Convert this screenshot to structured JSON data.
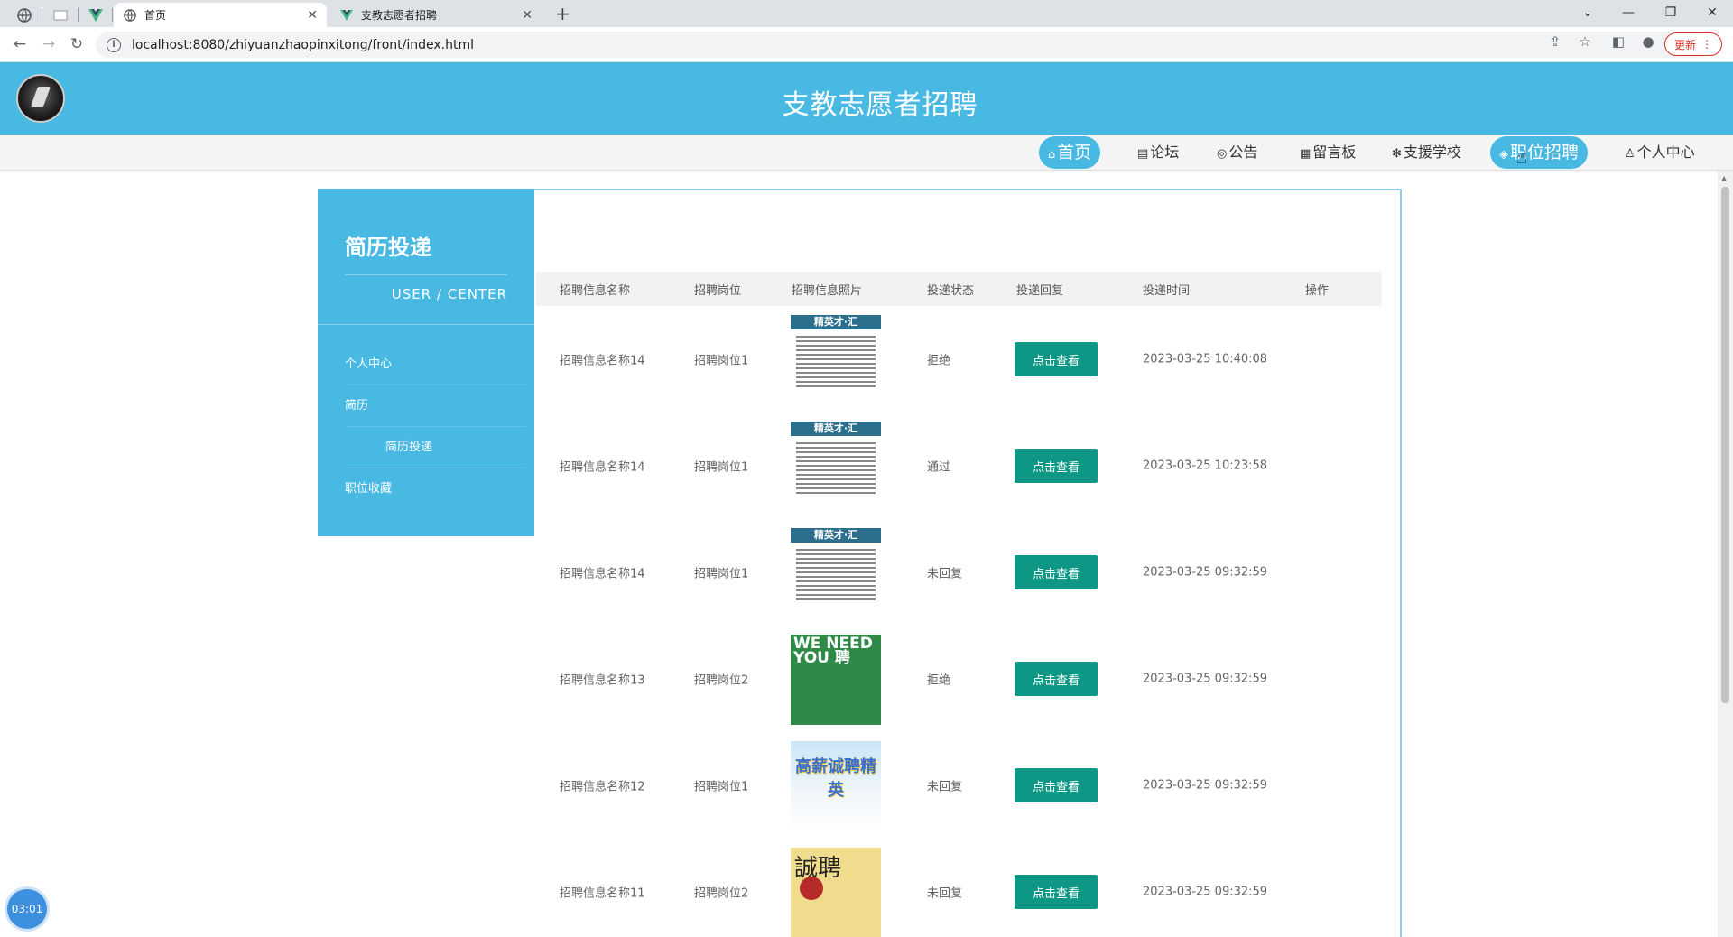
{
  "browser": {
    "tabs": [
      {
        "title": "首页",
        "icon": "globe-icon",
        "active": true
      },
      {
        "title": "支教志愿者招聘",
        "icon": "vue-logo-icon",
        "active": false
      }
    ],
    "url": "localhost:8080/zhiyuanzhaopinxitong/front/index.html",
    "update_label": "更新"
  },
  "site": {
    "title": "支教志愿者招聘"
  },
  "nav": {
    "items": [
      {
        "label": "首页",
        "icon": "⌂",
        "active": true
      },
      {
        "label": "论坛",
        "icon": "▤",
        "active": false
      },
      {
        "label": "公告",
        "icon": "◎",
        "active": false
      },
      {
        "label": "留言板",
        "icon": "▦",
        "active": false
      },
      {
        "label": "支援学校",
        "icon": "✻",
        "active": false
      },
      {
        "label": "职位招聘",
        "icon": "◈",
        "active": true
      },
      {
        "label": "个人中心",
        "icon": "♙",
        "active": false
      }
    ]
  },
  "sidebar": {
    "title": "简历投递",
    "subtitle": "USER / CENTER",
    "items": [
      {
        "label": "个人中心"
      },
      {
        "label": "简历"
      },
      {
        "label": "简历投递"
      },
      {
        "label": "职位收藏"
      }
    ]
  },
  "table": {
    "columns": [
      "招聘信息名称",
      "招聘岗位",
      "招聘信息照片",
      "投递状态",
      "投递回复",
      "投递时间",
      "操作"
    ],
    "button_label": "点击查看",
    "rows": [
      {
        "name": "招聘信息名称14",
        "position": "招聘岗位1",
        "poster": "a",
        "status": "拒绝",
        "time": "2023-03-25 10:40:08"
      },
      {
        "name": "招聘信息名称14",
        "position": "招聘岗位1",
        "poster": "a",
        "status": "通过",
        "time": "2023-03-25 10:23:58"
      },
      {
        "name": "招聘信息名称14",
        "position": "招聘岗位1",
        "poster": "a",
        "status": "未回复",
        "time": "2023-03-25 09:32:59"
      },
      {
        "name": "招聘信息名称13",
        "position": "招聘岗位2",
        "poster": "b",
        "status": "拒绝",
        "time": "2023-03-25 09:32:59"
      },
      {
        "name": "招聘信息名称12",
        "position": "招聘岗位1",
        "poster": "c",
        "status": "未回复",
        "time": "2023-03-25 09:32:59"
      },
      {
        "name": "招聘信息名称11",
        "position": "招聘岗位2",
        "poster": "d",
        "status": "未回复",
        "time": "2023-03-25 09:32:59"
      }
    ]
  },
  "posters": {
    "a_banner": "精英才·汇",
    "b_text": "WE NEED YOU 聘",
    "c_text": "高薪诚聘精英",
    "d_text": "誠聘"
  },
  "timer": "03:01",
  "colors": {
    "brand": "#47b9e3",
    "button": "#0e9784"
  }
}
